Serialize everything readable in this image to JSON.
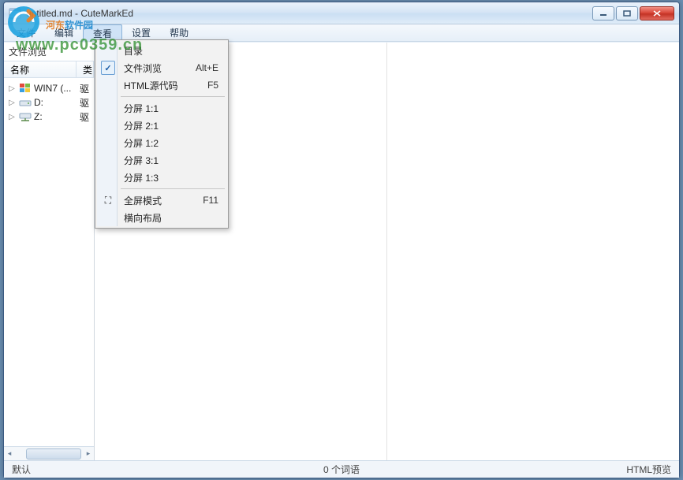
{
  "window": {
    "title": "untitled.md - CuteMarkEd"
  },
  "menubar": {
    "items": [
      "文件",
      "编辑",
      "查看",
      "设置",
      "帮助"
    ],
    "active_index": 2
  },
  "sidebar": {
    "title": "文件浏览",
    "columns": [
      "名称",
      "类"
    ],
    "tree": [
      {
        "label": "WIN7 (... ",
        "suffix": "驱",
        "icon": "win"
      },
      {
        "label": "D:",
        "suffix": "驱",
        "icon": "drive"
      },
      {
        "label": "Z:",
        "suffix": "驱",
        "icon": "net"
      }
    ]
  },
  "dropdown": {
    "items": [
      {
        "label": "目录",
        "checked": false,
        "shortcut": ""
      },
      {
        "label": "文件浏览",
        "checked": true,
        "shortcut": "Alt+E"
      },
      {
        "label": "HTML源代码",
        "checked": false,
        "shortcut": "F5"
      },
      {
        "sep": true
      },
      {
        "label": "分屏 1:1"
      },
      {
        "label": "分屏 2:1"
      },
      {
        "label": "分屏 1:2"
      },
      {
        "label": "分屏 3:1"
      },
      {
        "label": "分屏 1:3"
      },
      {
        "sep": true
      },
      {
        "label": "全屏模式",
        "shortcut": "F11",
        "icon": "fullscreen"
      },
      {
        "label": "横向布局"
      }
    ]
  },
  "statusbar": {
    "left": "默认",
    "center": "0 个词语",
    "right": "HTML预览"
  },
  "watermark": {
    "brand_a": "河东",
    "brand_b": "软件园",
    "url": "www.pc0359.cn"
  }
}
